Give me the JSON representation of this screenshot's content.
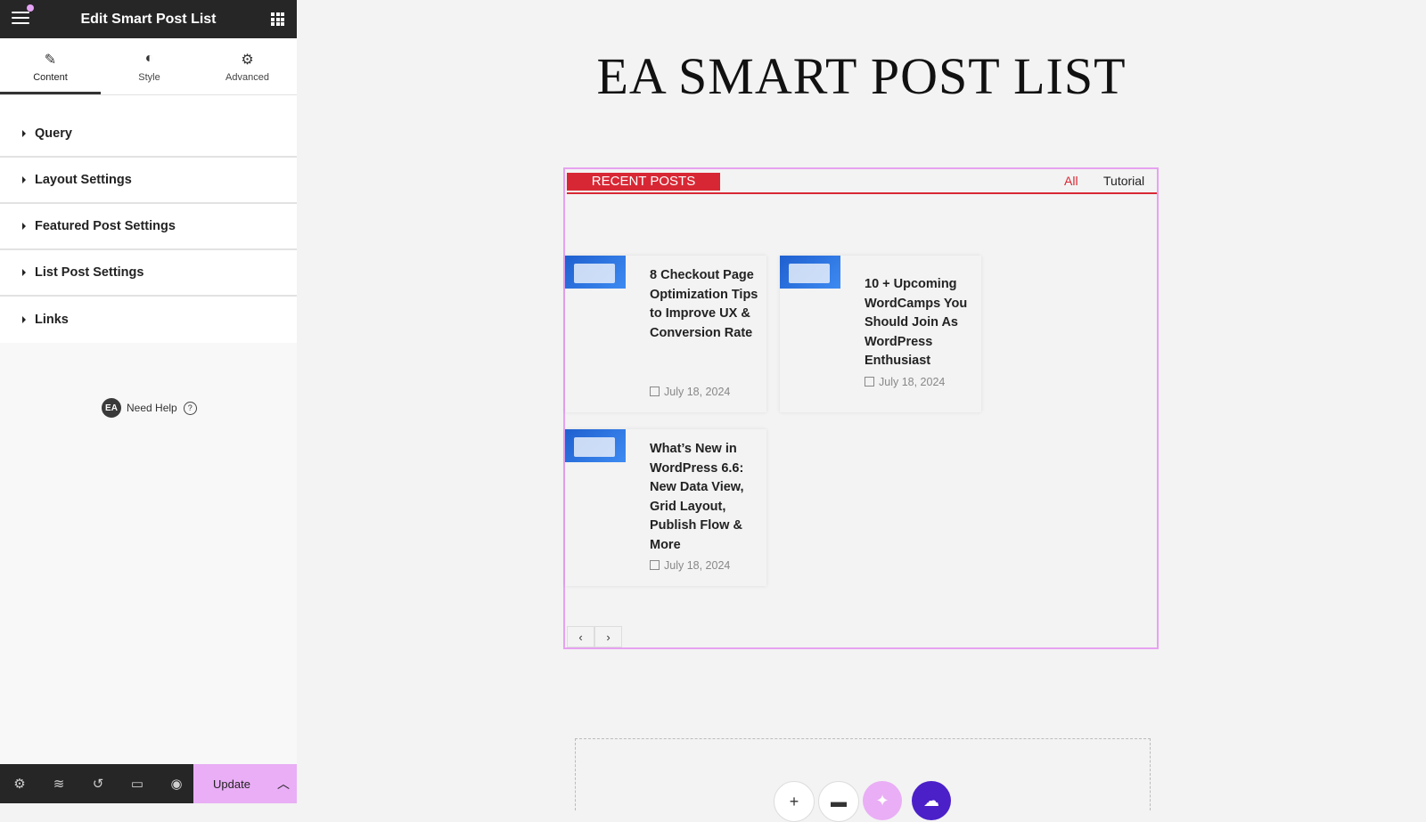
{
  "editor": {
    "title": "Edit Smart Post List",
    "tabs": [
      {
        "label": "Content",
        "icon": "pencil-icon"
      },
      {
        "label": "Style",
        "icon": "half-circle-icon"
      },
      {
        "label": "Advanced",
        "icon": "gear-icon"
      }
    ],
    "sections": [
      {
        "label": "Query"
      },
      {
        "label": "Layout Settings"
      },
      {
        "label": "Featured Post Settings"
      },
      {
        "label": "List Post Settings"
      },
      {
        "label": "Links"
      }
    ],
    "help": {
      "badge": "EA",
      "label": "Need Help",
      "icon": "?"
    },
    "bottom": {
      "update_label": "Update"
    }
  },
  "page": {
    "heading": "EA SMART POST LIST",
    "widget": {
      "badge": "RECENT POSTS",
      "filters": [
        "All",
        "Tutorial"
      ],
      "posts": [
        {
          "title": "8 Checkout Page Optimization Tips to Improve UX & Conversion Rate",
          "date": "July 18, 2024"
        },
        {
          "title": "10 + Upcoming WordCamps You Should Join As WordPress Enthusiast",
          "date": "July 18, 2024"
        },
        {
          "title": "What’s New in WordPress 6.6: New Data View, Grid Layout, Publish Flow & More",
          "date": "July 18, 2024"
        }
      ]
    }
  },
  "colors": {
    "accent": "#d82734",
    "update_bg": "#e9aef5",
    "widget_border": "#e6a2f0",
    "sidebar_dark": "#262626"
  }
}
